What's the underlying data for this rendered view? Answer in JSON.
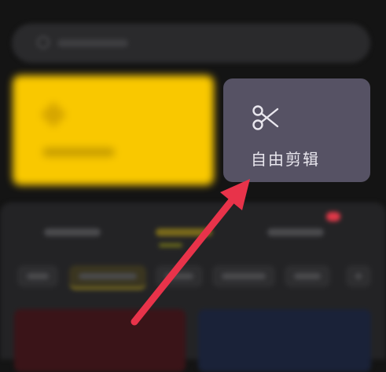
{
  "free_edit": {
    "label": "自由剪辑",
    "icon": "scissors-icon",
    "background": "#565264"
  },
  "yellow_card": {
    "background": "#f9c800",
    "icon": "diamond-icon"
  },
  "bottom_panel": {
    "badge_color": "#e03848"
  },
  "annotation": {
    "arrow_color": "#e8334a",
    "arrow_icon": "arrow-icon"
  }
}
